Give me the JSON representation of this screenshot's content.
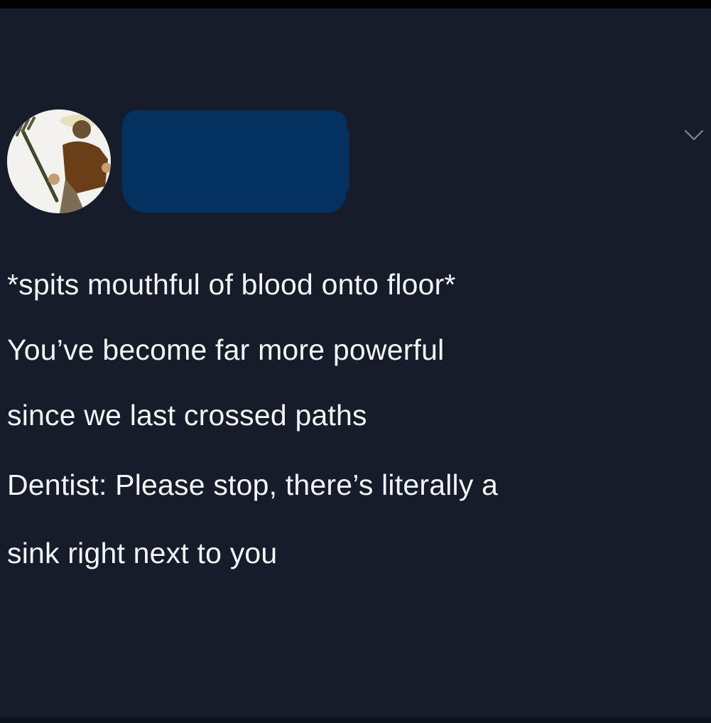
{
  "tweet": {
    "avatar_icon": "avatar-image",
    "menu_icon": "chevron-down-icon",
    "text_lines": [
      "*spits mouthful of blood onto floor*",
      "You’ve become far more powerful",
      "since we last crossed paths"
    ],
    "reply_lines": [
      "Dentist: Please stop, there’s literally a",
      "sink right next to you"
    ]
  },
  "colors": {
    "background": "#161c29",
    "text": "#f3f4f6",
    "redaction": "#033160",
    "top_band": "#030304"
  }
}
